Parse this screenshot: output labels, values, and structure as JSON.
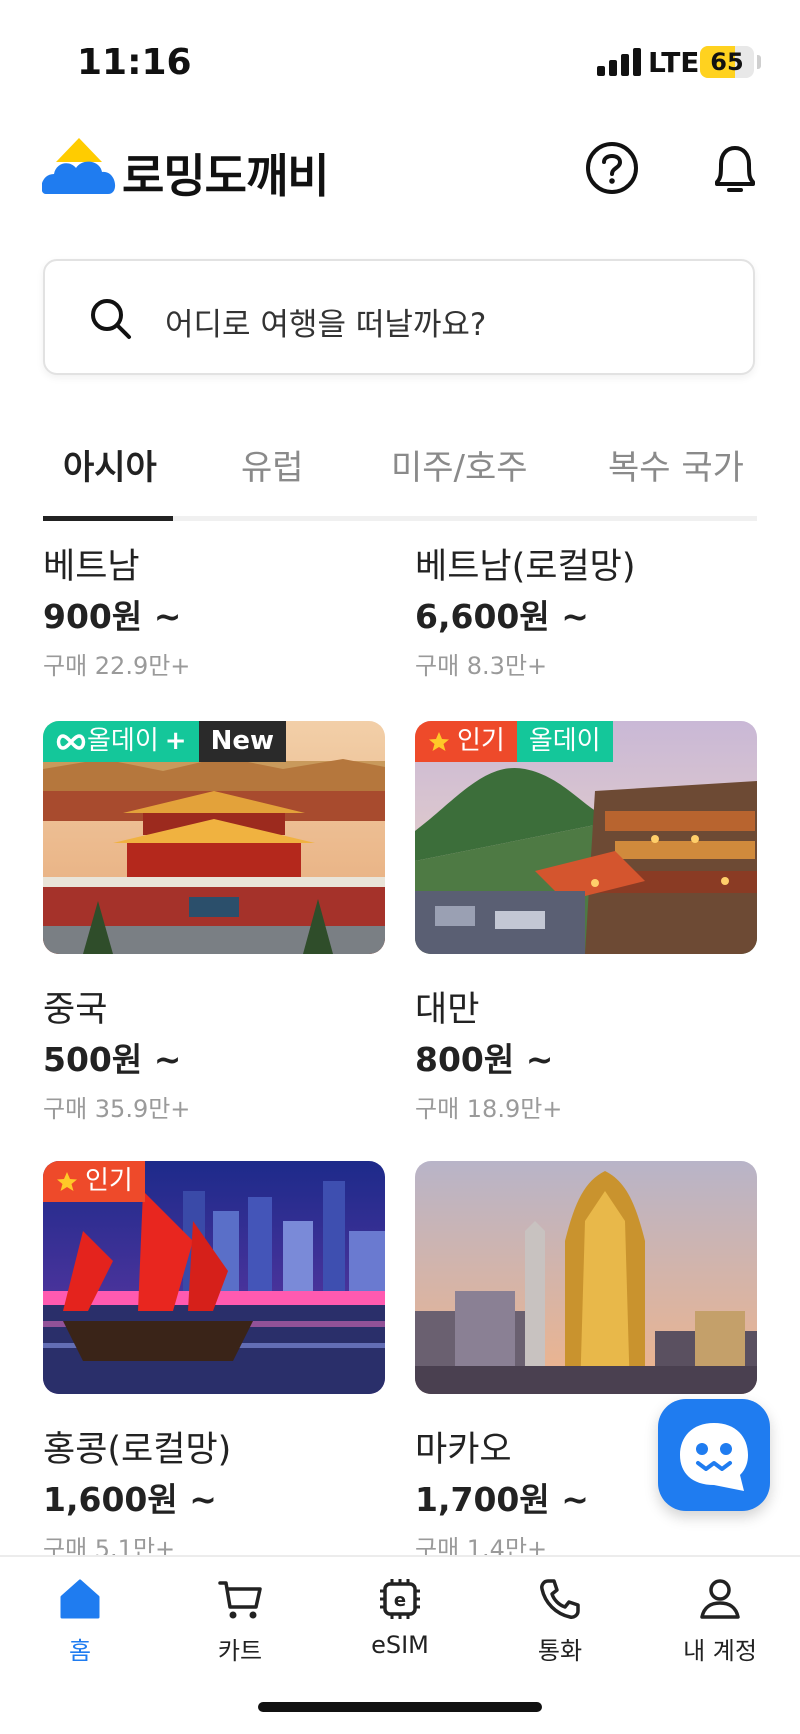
{
  "status_bar": {
    "time": "11:16",
    "network": "LTE",
    "battery": "65",
    "battery_level": 0.65
  },
  "header": {
    "brand": "로밍도깨비",
    "help_icon": "help-circle-icon",
    "notification_icon": "bell-icon"
  },
  "search": {
    "placeholder": "어디로 여행을 떠날까요?"
  },
  "tabs": [
    {
      "label": "아시아",
      "active": true
    },
    {
      "label": "유럽",
      "active": false
    },
    {
      "label": "미주/호주",
      "active": false
    },
    {
      "label": "복수 국가",
      "active": false
    }
  ],
  "products": [
    {
      "name": "베트남",
      "price": "900원 ~",
      "sales": "구매 22.9만+"
    },
    {
      "name": "베트남(로컬망)",
      "price": "6,600원 ~",
      "sales": "구매 8.3만+"
    },
    {
      "name": "중국",
      "price": "500원 ~",
      "sales": "구매 35.9만+",
      "badges": [
        "올데이",
        "New"
      ]
    },
    {
      "name": "대만",
      "price": "800원 ~",
      "sales": "구매 18.9만+",
      "badges": [
        "인기",
        "올데이"
      ]
    },
    {
      "name": "홍콩(로컬망)",
      "price": "1,600원 ~",
      "sales": "구매 5.1만+",
      "badges": [
        "인기"
      ]
    },
    {
      "name": "마카오",
      "price": "1,700원 ~",
      "sales": "구매 1.4만+"
    }
  ],
  "chat": {
    "icon": "chat-bot-icon"
  },
  "bottom_nav": [
    {
      "label": "홈",
      "icon": "home-icon",
      "active": true
    },
    {
      "label": "카트",
      "icon": "cart-icon",
      "active": false
    },
    {
      "label": "eSIM",
      "icon": "esim-chip-icon",
      "active": false
    },
    {
      "label": "통화",
      "icon": "phone-icon",
      "active": false
    },
    {
      "label": "내 계정",
      "icon": "person-icon",
      "active": false
    }
  ],
  "colors": {
    "accent": "#1f7cf0",
    "allday_badge": "#14c79a",
    "popular_badge": "#ee4a2a",
    "new_badge": "#2a2a2a",
    "battery": "#ffd21f"
  }
}
